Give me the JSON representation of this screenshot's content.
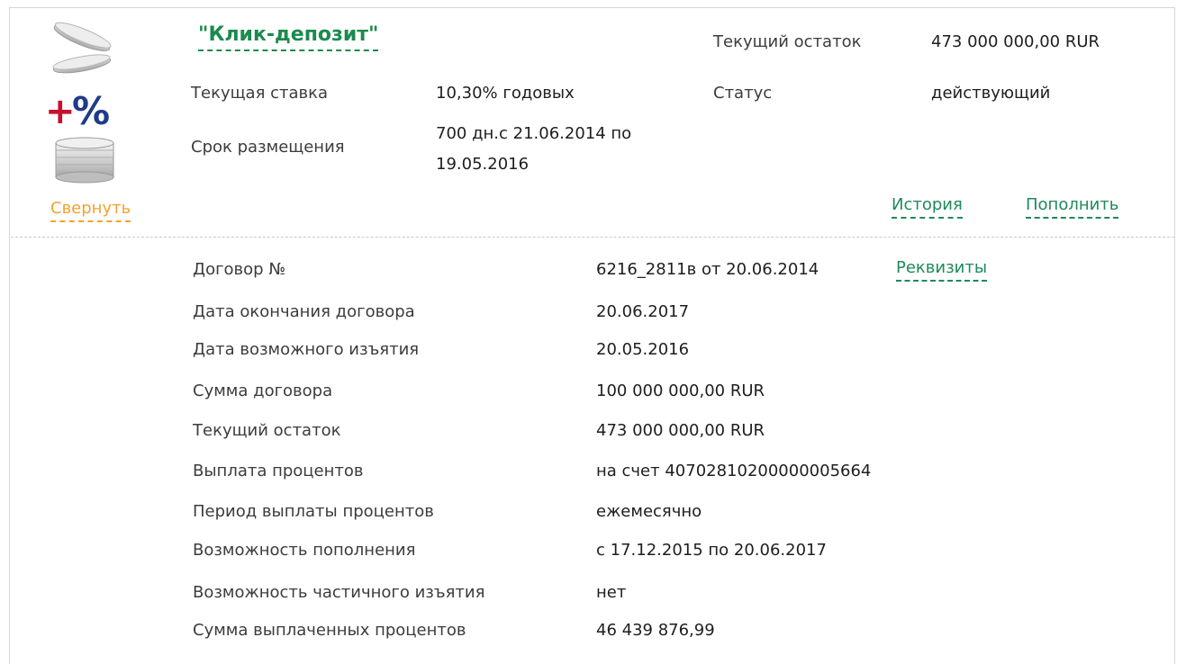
{
  "deposit": {
    "title": "\"Клик-депозит\"",
    "rate_label": "Текущая ставка",
    "rate_value": "10,30% годовых",
    "term_label": "Срок размещения",
    "term_value": "700 дн.с 21.06.2014 по 19.05.2016",
    "balance_label": "Текущий остаток",
    "balance_value": "473 000 000,00 RUR",
    "status_label": "Статус",
    "status_value": "действующий"
  },
  "actions": {
    "collapse": "Свернуть",
    "history": "История",
    "topup": "Пополнить",
    "details": "Реквизиты"
  },
  "icon": {
    "name": "deposit-percent-coins-icon",
    "plus_color": "#c8102e",
    "percent_color": "#1f3b8c"
  },
  "details": [
    {
      "label": "Договор №",
      "value": "6216_2811в от 20.06.2014"
    },
    {
      "label": "Дата окончания договора",
      "value": "20.06.2017"
    },
    {
      "label": "Дата возможного изъятия",
      "value": "20.05.2016"
    },
    {
      "label": "Сумма договора",
      "value": "100 000 000,00 RUR"
    },
    {
      "label": "Текущий остаток",
      "value": "473 000 000,00 RUR"
    },
    {
      "label": "Выплата процентов",
      "value": "на счет 40702810200000005664"
    },
    {
      "label": "Период выплаты процентов",
      "value": "ежемесячно"
    },
    {
      "label": "Возможность пополнения",
      "value": "с 17.12.2015 по 20.06.2017"
    },
    {
      "label": "Возможность частичного изъятия",
      "value": "нет"
    },
    {
      "label": "Сумма выплаченных процентов",
      "value": "46 439 876,99"
    }
  ],
  "colors": {
    "link_green": "#1e8a5a",
    "collapse_orange": "#f2a32e",
    "border_gray": "#d6d6d6"
  }
}
